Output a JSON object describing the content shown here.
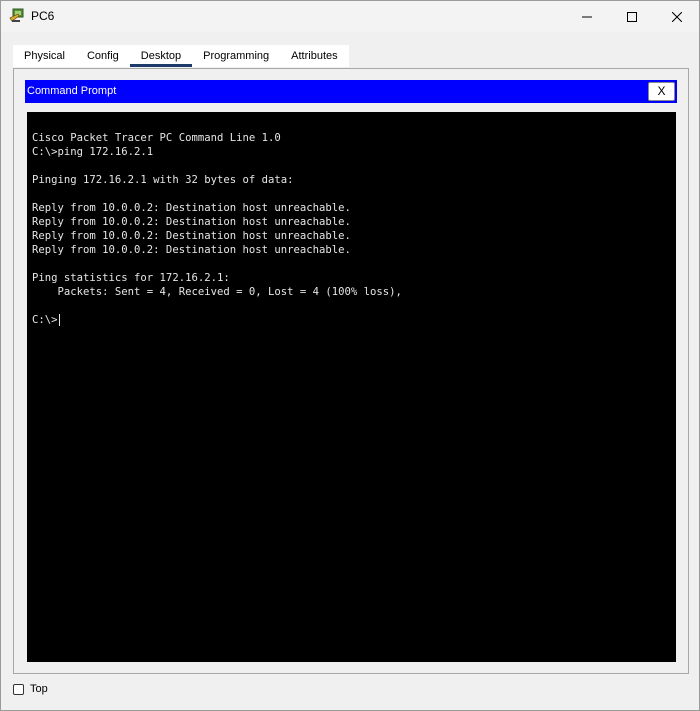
{
  "window": {
    "title": "PC6"
  },
  "tabs": [
    {
      "label": "Physical",
      "active": false
    },
    {
      "label": "Config",
      "active": false
    },
    {
      "label": "Desktop",
      "active": true
    },
    {
      "label": "Programming",
      "active": false
    },
    {
      "label": "Attributes",
      "active": false
    }
  ],
  "command_prompt": {
    "title": "Command Prompt",
    "close_label": "X",
    "lines": [
      "Cisco Packet Tracer PC Command Line 1.0",
      "C:\\>ping 172.16.2.1",
      "",
      "Pinging 172.16.2.1 with 32 bytes of data:",
      "",
      "Reply from 10.0.0.2: Destination host unreachable.",
      "Reply from 10.0.0.2: Destination host unreachable.",
      "Reply from 10.0.0.2: Destination host unreachable.",
      "Reply from 10.0.0.2: Destination host unreachable.",
      "",
      "Ping statistics for 172.16.2.1:",
      "    Packets: Sent = 4, Received = 0, Lost = 4 (100% loss),",
      ""
    ],
    "prompt": "C:\\>"
  },
  "footer": {
    "top_label": "Top",
    "top_checked": false
  },
  "colors": {
    "header_blue": "#0000ff",
    "terminal_bg": "#000000",
    "terminal_text": "#e6e6e6",
    "active_tab_underline": "#1e3a6b"
  }
}
